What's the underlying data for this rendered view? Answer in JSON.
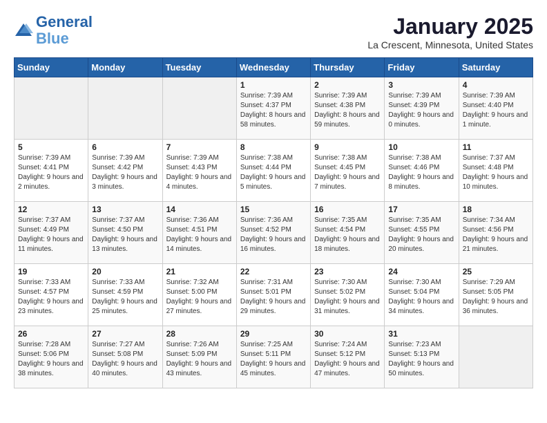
{
  "header": {
    "logo_line1": "General",
    "logo_line2": "Blue",
    "month": "January 2025",
    "location": "La Crescent, Minnesota, United States"
  },
  "days_of_week": [
    "Sunday",
    "Monday",
    "Tuesday",
    "Wednesday",
    "Thursday",
    "Friday",
    "Saturday"
  ],
  "weeks": [
    [
      {
        "day": "",
        "info": ""
      },
      {
        "day": "",
        "info": ""
      },
      {
        "day": "",
        "info": ""
      },
      {
        "day": "1",
        "info": "Sunrise: 7:39 AM\nSunset: 4:37 PM\nDaylight: 8 hours and 58 minutes."
      },
      {
        "day": "2",
        "info": "Sunrise: 7:39 AM\nSunset: 4:38 PM\nDaylight: 8 hours and 59 minutes."
      },
      {
        "day": "3",
        "info": "Sunrise: 7:39 AM\nSunset: 4:39 PM\nDaylight: 9 hours and 0 minutes."
      },
      {
        "day": "4",
        "info": "Sunrise: 7:39 AM\nSunset: 4:40 PM\nDaylight: 9 hours and 1 minute."
      }
    ],
    [
      {
        "day": "5",
        "info": "Sunrise: 7:39 AM\nSunset: 4:41 PM\nDaylight: 9 hours and 2 minutes."
      },
      {
        "day": "6",
        "info": "Sunrise: 7:39 AM\nSunset: 4:42 PM\nDaylight: 9 hours and 3 minutes."
      },
      {
        "day": "7",
        "info": "Sunrise: 7:39 AM\nSunset: 4:43 PM\nDaylight: 9 hours and 4 minutes."
      },
      {
        "day": "8",
        "info": "Sunrise: 7:38 AM\nSunset: 4:44 PM\nDaylight: 9 hours and 5 minutes."
      },
      {
        "day": "9",
        "info": "Sunrise: 7:38 AM\nSunset: 4:45 PM\nDaylight: 9 hours and 7 minutes."
      },
      {
        "day": "10",
        "info": "Sunrise: 7:38 AM\nSunset: 4:46 PM\nDaylight: 9 hours and 8 minutes."
      },
      {
        "day": "11",
        "info": "Sunrise: 7:37 AM\nSunset: 4:48 PM\nDaylight: 9 hours and 10 minutes."
      }
    ],
    [
      {
        "day": "12",
        "info": "Sunrise: 7:37 AM\nSunset: 4:49 PM\nDaylight: 9 hours and 11 minutes."
      },
      {
        "day": "13",
        "info": "Sunrise: 7:37 AM\nSunset: 4:50 PM\nDaylight: 9 hours and 13 minutes."
      },
      {
        "day": "14",
        "info": "Sunrise: 7:36 AM\nSunset: 4:51 PM\nDaylight: 9 hours and 14 minutes."
      },
      {
        "day": "15",
        "info": "Sunrise: 7:36 AM\nSunset: 4:52 PM\nDaylight: 9 hours and 16 minutes."
      },
      {
        "day": "16",
        "info": "Sunrise: 7:35 AM\nSunset: 4:54 PM\nDaylight: 9 hours and 18 minutes."
      },
      {
        "day": "17",
        "info": "Sunrise: 7:35 AM\nSunset: 4:55 PM\nDaylight: 9 hours and 20 minutes."
      },
      {
        "day": "18",
        "info": "Sunrise: 7:34 AM\nSunset: 4:56 PM\nDaylight: 9 hours and 21 minutes."
      }
    ],
    [
      {
        "day": "19",
        "info": "Sunrise: 7:33 AM\nSunset: 4:57 PM\nDaylight: 9 hours and 23 minutes."
      },
      {
        "day": "20",
        "info": "Sunrise: 7:33 AM\nSunset: 4:59 PM\nDaylight: 9 hours and 25 minutes."
      },
      {
        "day": "21",
        "info": "Sunrise: 7:32 AM\nSunset: 5:00 PM\nDaylight: 9 hours and 27 minutes."
      },
      {
        "day": "22",
        "info": "Sunrise: 7:31 AM\nSunset: 5:01 PM\nDaylight: 9 hours and 29 minutes."
      },
      {
        "day": "23",
        "info": "Sunrise: 7:30 AM\nSunset: 5:02 PM\nDaylight: 9 hours and 31 minutes."
      },
      {
        "day": "24",
        "info": "Sunrise: 7:30 AM\nSunset: 5:04 PM\nDaylight: 9 hours and 34 minutes."
      },
      {
        "day": "25",
        "info": "Sunrise: 7:29 AM\nSunset: 5:05 PM\nDaylight: 9 hours and 36 minutes."
      }
    ],
    [
      {
        "day": "26",
        "info": "Sunrise: 7:28 AM\nSunset: 5:06 PM\nDaylight: 9 hours and 38 minutes."
      },
      {
        "day": "27",
        "info": "Sunrise: 7:27 AM\nSunset: 5:08 PM\nDaylight: 9 hours and 40 minutes."
      },
      {
        "day": "28",
        "info": "Sunrise: 7:26 AM\nSunset: 5:09 PM\nDaylight: 9 hours and 43 minutes."
      },
      {
        "day": "29",
        "info": "Sunrise: 7:25 AM\nSunset: 5:11 PM\nDaylight: 9 hours and 45 minutes."
      },
      {
        "day": "30",
        "info": "Sunrise: 7:24 AM\nSunset: 5:12 PM\nDaylight: 9 hours and 47 minutes."
      },
      {
        "day": "31",
        "info": "Sunrise: 7:23 AM\nSunset: 5:13 PM\nDaylight: 9 hours and 50 minutes."
      },
      {
        "day": "",
        "info": ""
      }
    ]
  ]
}
